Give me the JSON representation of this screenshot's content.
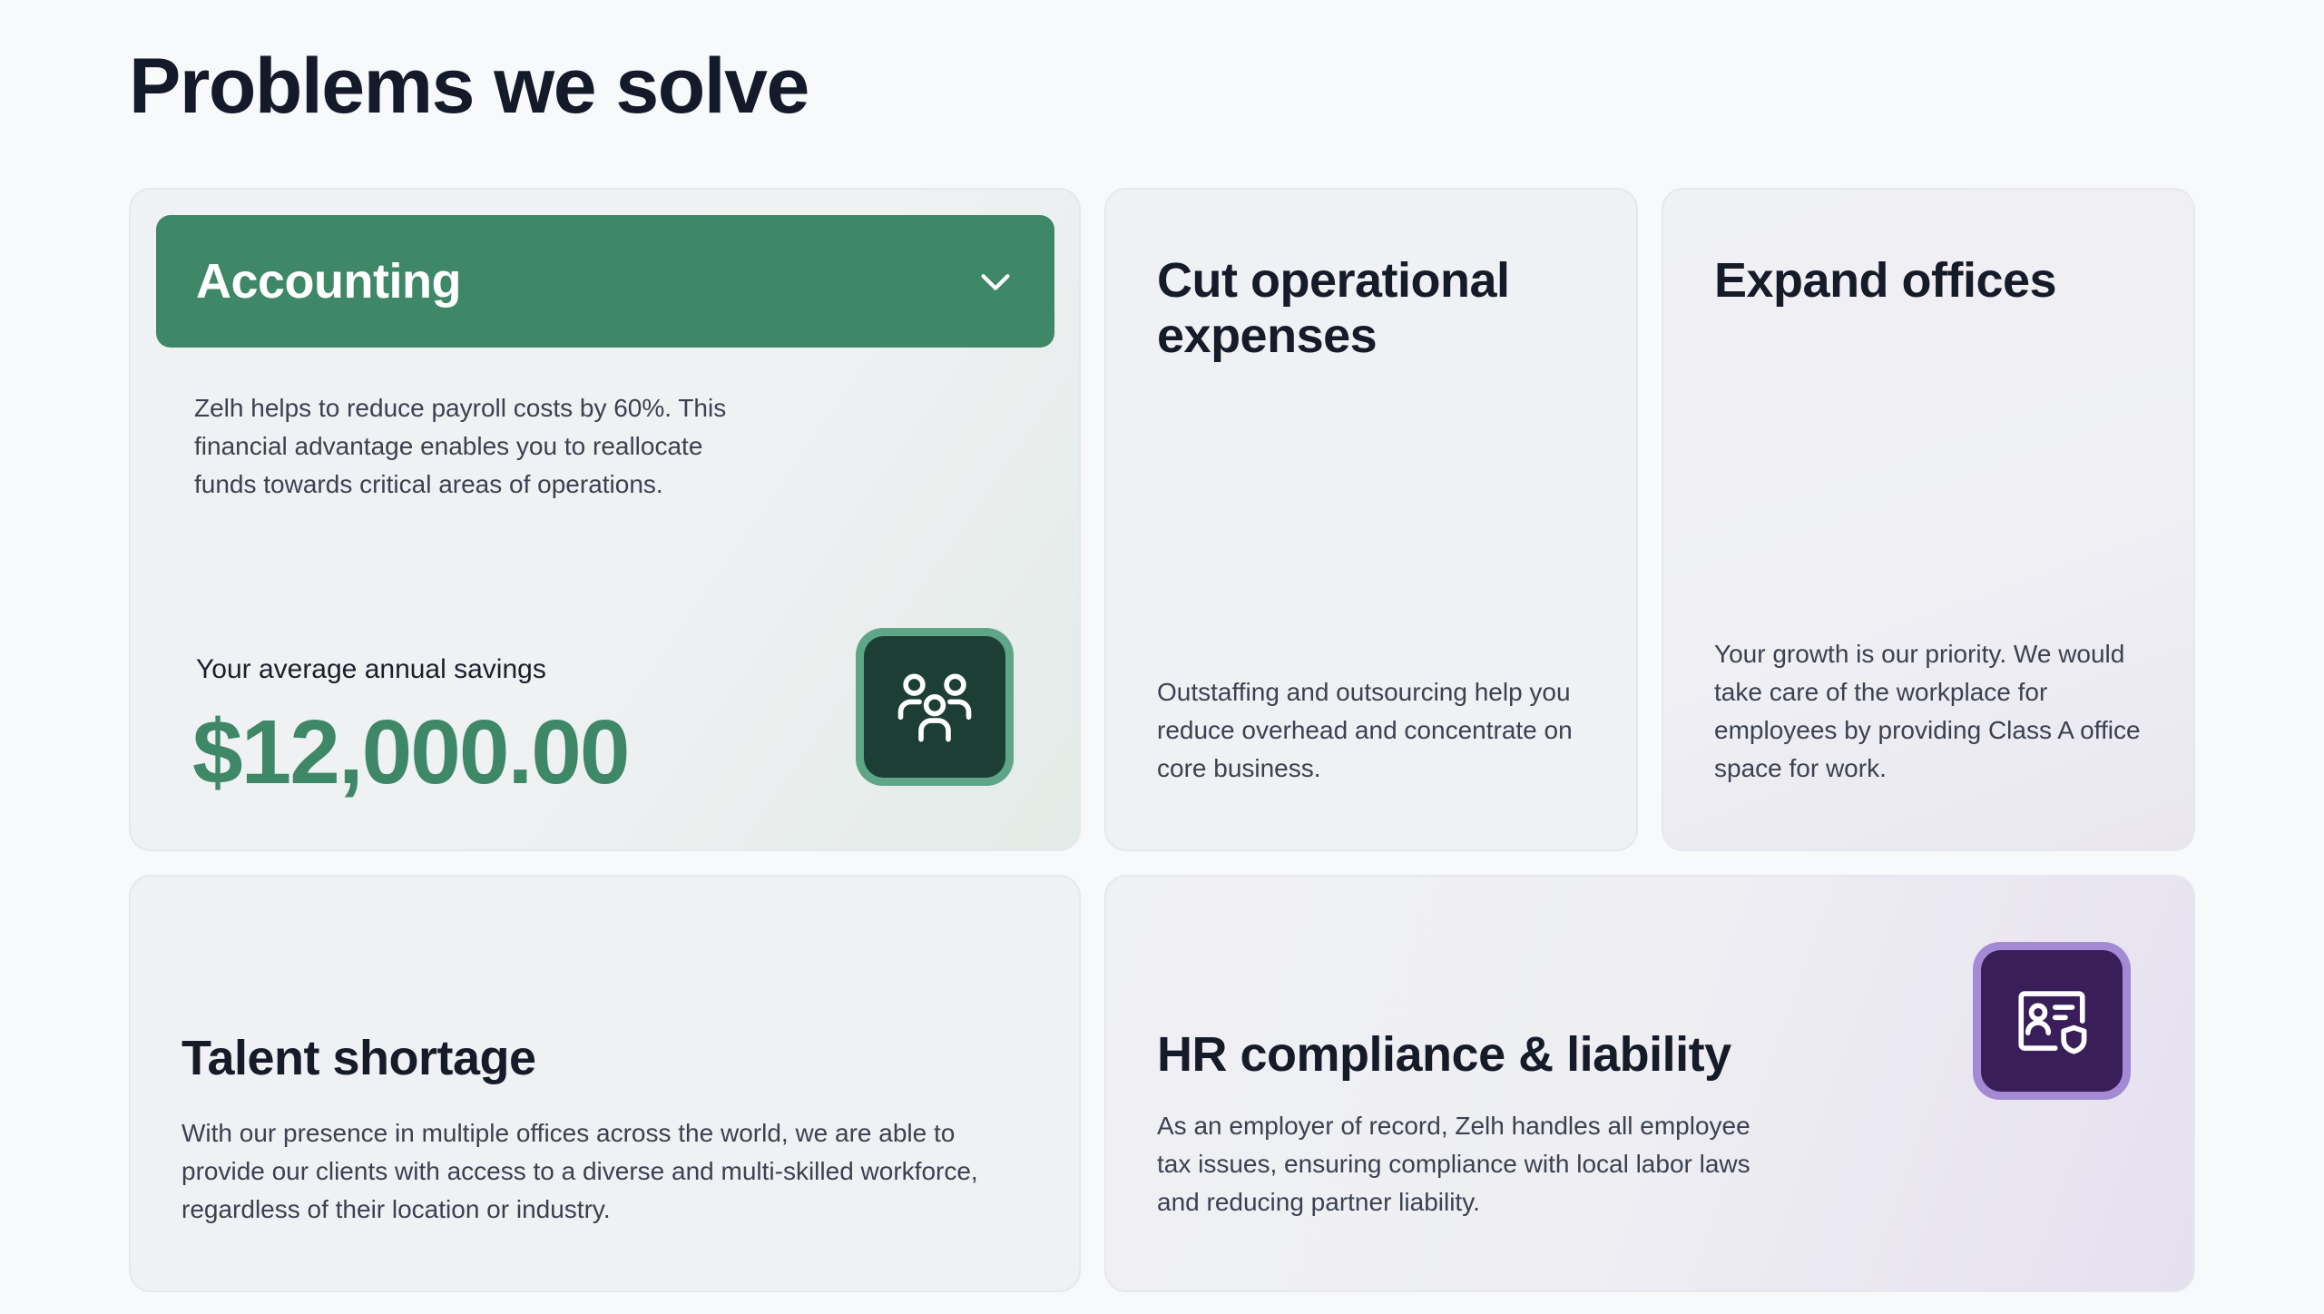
{
  "page": {
    "title": "Problems we solve"
  },
  "colors": {
    "accent_green": "#3e8867",
    "green_tile_dark": "#1c3e34",
    "purple_tile_dark": "#3a1e5a",
    "purple_tile_border": "#a48ad4",
    "heading": "#141a2a",
    "body_text": "#3b4150"
  },
  "cards": {
    "accounting": {
      "label": "Accounting",
      "expanded": true,
      "toggle_icon": "chevron-down-icon",
      "description": "Zelh helps to reduce payroll costs by 60%. This financial advantage enables you to reallocate funds towards critical areas of operations.",
      "savings_label": "Your average annual savings",
      "savings_value": "$12,000.00",
      "icon": "team-users-icon"
    },
    "opex": {
      "title": "Cut operational expenses",
      "description": "Outstaffing and outsourcing help you reduce overhead and concentrate on core business."
    },
    "offices": {
      "title": "Expand offices",
      "description": "Your growth is our priority. We would take care of the workplace for employees by providing Class A office space for work."
    },
    "talent": {
      "title": "Talent shortage",
      "description": "With our presence in multiple offices across the world, we are able to provide our clients with access to a diverse and multi-skilled workforce, regardless of their location or industry."
    },
    "hr": {
      "title": "HR compliance & liability",
      "description": "As an employer of record, Zelh handles all employee tax issues, ensuring compliance with local labor laws and reducing partner liability.",
      "icon": "id-card-shield-icon"
    }
  }
}
